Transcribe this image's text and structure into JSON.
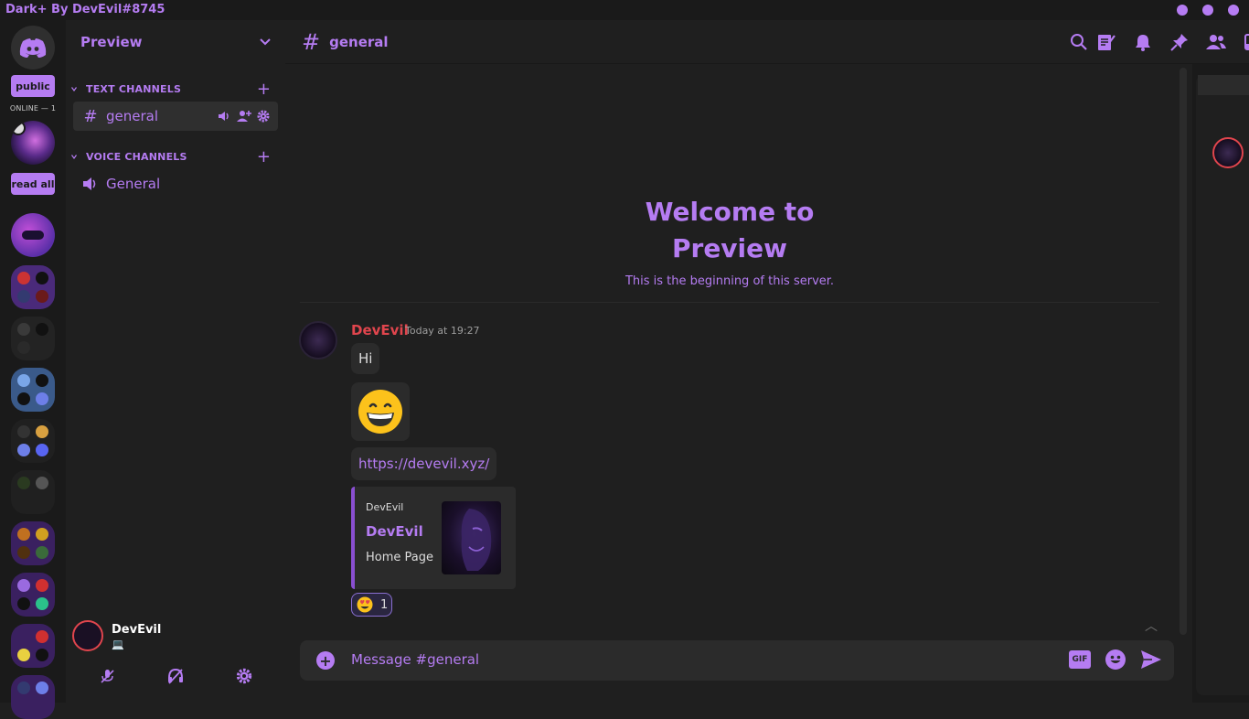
{
  "window": {
    "title": "Dark+ By DevEvil#8745"
  },
  "rail": {
    "public_label": "public",
    "online_label": "ONLINE — 1",
    "read_all_label": "read all"
  },
  "sidebar": {
    "server_name": "Preview",
    "categories": [
      {
        "label": "TEXT CHANNELS"
      },
      {
        "label": "VOICE CHANNELS"
      }
    ],
    "text_channels": [
      {
        "name": "general"
      }
    ],
    "voice_channels": [
      {
        "name": "General"
      }
    ]
  },
  "user": {
    "name": "DevEvil",
    "status_icon": "laptop-icon"
  },
  "chat": {
    "channel": "general",
    "welcome_line1": "Welcome to",
    "welcome_line2": "Preview",
    "welcome_sub": "This is the beginning of this server.",
    "message": {
      "author": "DevEvil",
      "timestamp": "Today at 19:27",
      "text1": "Hi",
      "emoji": "grinning-face",
      "link": "https://devevil.xyz/"
    },
    "embed": {
      "provider": "DevEvil",
      "title": "DevEvil",
      "description": "Home Page"
    },
    "reaction": {
      "emoji": "heart-eyes",
      "count": "1"
    },
    "composer_placeholder": "Message #general",
    "gif_label": "GIF"
  },
  "colors": {
    "accent": "#b57cf2",
    "author": "#e0454d",
    "background": "#1f1f1f"
  }
}
